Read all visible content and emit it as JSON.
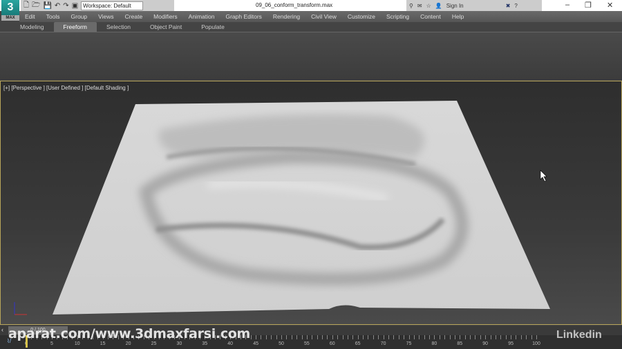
{
  "app": {
    "logo_text": "3",
    "logo_sub": "MAX",
    "filename": "09_06_conform_transform.max",
    "workspace": "Workspace: Default"
  },
  "infocenter": {
    "sign_in": "Sign In"
  },
  "menu": [
    "Edit",
    "Tools",
    "Group",
    "Views",
    "Create",
    "Modifiers",
    "Animation",
    "Graph Editors",
    "Rendering",
    "Civil View",
    "Customize",
    "Scripting",
    "Content",
    "Help"
  ],
  "ribbon_tabs": [
    {
      "label": "Modeling"
    },
    {
      "label": "Freeform",
      "active": true
    },
    {
      "label": "Selection"
    },
    {
      "label": "Object Paint"
    },
    {
      "label": "Populate"
    }
  ],
  "viewport": {
    "label": "[+] [Perspective ] [User Defined ] [Default Shading ]"
  },
  "timeline": {
    "frame": "0 / 100",
    "ticks": [
      "0",
      "5",
      "10",
      "15",
      "20",
      "25",
      "30",
      "35",
      "40",
      "45",
      "50",
      "55",
      "60",
      "65",
      "70",
      "75",
      "80",
      "85",
      "90",
      "95",
      "100"
    ]
  },
  "watermark": "aparat.com/www.3dmaxfarsi.com",
  "linkedin": "Linkedin",
  "colors": {
    "viewport_border": "#b8a55a",
    "accent": "#2aa6a0"
  }
}
